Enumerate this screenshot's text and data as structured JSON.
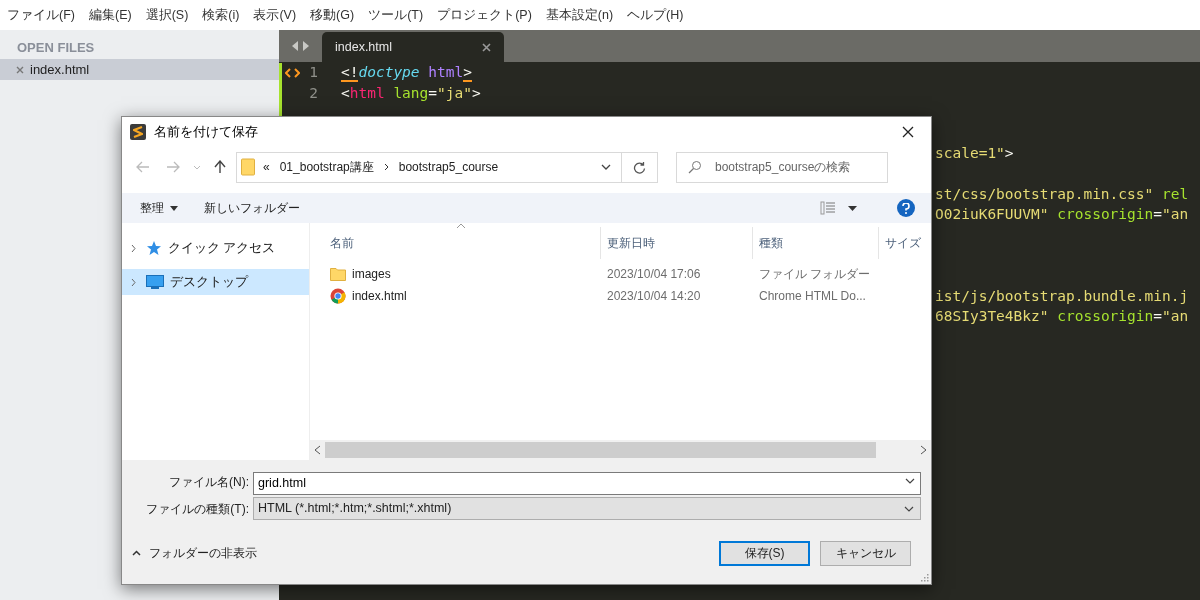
{
  "menu": [
    "ファイル(F)",
    "編集(E)",
    "選択(S)",
    "検索(i)",
    "表示(V)",
    "移動(G)",
    "ツール(T)",
    "プロジェクト(P)",
    "基本設定(n)",
    "ヘルプ(H)"
  ],
  "sidebar": {
    "heading": "OPEN FILES",
    "files": [
      {
        "name": "index.html",
        "selected": true
      }
    ]
  },
  "tabs": [
    {
      "label": "index.html",
      "selected": true
    }
  ],
  "code": [
    {
      "number": "1",
      "kind": "full",
      "marked": true,
      "tokens": [
        {
          "text": "<!",
          "kind": "punct"
        },
        {
          "text": "doctype",
          "kind": "doctype"
        },
        {
          "text": " html",
          "kind": "keyword"
        },
        {
          "text": ">",
          "kind": "punct"
        }
      ]
    },
    {
      "number": "2",
      "kind": "full",
      "marked": false,
      "tokens": [
        {
          "text": "<",
          "kind": "punct"
        },
        {
          "text": "html",
          "kind": "tag"
        },
        {
          "text": " lang",
          "kind": "attr"
        },
        {
          "text": "=",
          "kind": "punct"
        },
        {
          "text": "\"ja\"",
          "kind": "string"
        },
        {
          "text": ">",
          "kind": "punct"
        }
      ]
    },
    {
      "kind": "covered",
      "marked": false
    },
    {
      "kind": "covered",
      "marked": false
    },
    {
      "kind": "clipped",
      "marked": false,
      "tokens": [
        {
          "text": "scale=1\"",
          "kind": "string"
        },
        {
          "text": ">",
          "kind": "punct"
        }
      ]
    },
    {
      "kind": "covered",
      "marked": false
    },
    {
      "kind": "clipped",
      "marked": false,
      "tokens": [
        {
          "text": "st/css/bootstrap.min.css\"",
          "kind": "string"
        },
        {
          "text": " rel",
          "kind": "attr"
        }
      ]
    },
    {
      "kind": "clipped",
      "marked": false,
      "tokens": [
        {
          "text": "O02iuK6FUUVM\"",
          "kind": "string"
        },
        {
          "text": " crossorigin",
          "kind": "attr"
        },
        {
          "text": "=",
          "kind": "punct"
        },
        {
          "text": "\"an",
          "kind": "string"
        }
      ]
    },
    {
      "kind": "covered",
      "marked": false
    },
    {
      "kind": "covered",
      "marked": false
    },
    {
      "kind": "covered",
      "marked": false
    },
    {
      "kind": "clipped",
      "marked": false,
      "tokens": [
        {
          "text": "ist/js/bootstrap.bundle.min.j",
          "kind": "string"
        }
      ]
    },
    {
      "kind": "clipped",
      "marked": false,
      "tokens": [
        {
          "text": "68SIy3Te4Bkz\"",
          "kind": "string"
        },
        {
          "text": " crossorigin",
          "kind": "attr"
        },
        {
          "text": "=",
          "kind": "punct"
        },
        {
          "text": "\"an",
          "kind": "string"
        }
      ]
    }
  ],
  "dialog": {
    "title": "名前を付けて保存",
    "breadcrumb": [
      "«",
      "01_bootstrap講座",
      "bootstrap5_course"
    ],
    "search": {
      "placeholder": "bootstrap5_courseの検索"
    },
    "toolbar": [
      "整理",
      "新しいフォルダー"
    ],
    "nav": [
      {
        "label": "クイック アクセス",
        "kind": "star",
        "selected": false
      },
      {
        "label": "デスクトップ",
        "kind": "desktop",
        "selected": true
      }
    ],
    "columns": [
      "名前",
      "更新日時",
      "種類",
      "サイズ"
    ],
    "files": [
      {
        "name": "images",
        "kind": "folder",
        "modified": "2023/10/04 17:06",
        "type": "ファイル フォルダー"
      },
      {
        "name": "index.html",
        "kind": "browser",
        "modified": "2023/10/04 14:20",
        "type": "Chrome HTML Do..."
      }
    ],
    "filename": {
      "label": "ファイル名(N):",
      "value": "grid.html"
    },
    "filetype": {
      "label": "ファイルの種類(T):",
      "value": "HTML (*.html;*.htm;*.shtml;*.xhtml)"
    },
    "hide_folders": "フォルダーの非表示",
    "buttons": [
      {
        "label": "保存(S)",
        "kind": "primary"
      },
      {
        "label": "キャンセル",
        "kind": "normal"
      }
    ]
  }
}
